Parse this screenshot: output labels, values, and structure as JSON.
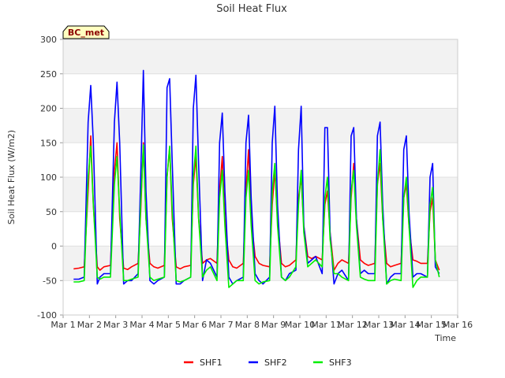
{
  "chart_data": {
    "type": "line",
    "title": "Soil Heat Flux",
    "xlabel": "Time",
    "ylabel": "Soil Heat Flux (W/m2)",
    "badge": "BC_met",
    "xlim": [
      1,
      16
    ],
    "ylim": [
      -100,
      300
    ],
    "x_ticks": [
      {
        "value": 1,
        "label": "Mar 1"
      },
      {
        "value": 2,
        "label": "Mar 2"
      },
      {
        "value": 3,
        "label": "Mar 3"
      },
      {
        "value": 4,
        "label": "Mar 4"
      },
      {
        "value": 5,
        "label": "Mar 5"
      },
      {
        "value": 6,
        "label": "Mar 6"
      },
      {
        "value": 7,
        "label": "Mar 7"
      },
      {
        "value": 8,
        "label": "Mar 8"
      },
      {
        "value": 9,
        "label": "Mar 9"
      },
      {
        "value": 10,
        "label": "Mar 10"
      },
      {
        "value": 11,
        "label": "Mar 11"
      },
      {
        "value": 12,
        "label": "Mar 12"
      },
      {
        "value": 13,
        "label": "Mar 13"
      },
      {
        "value": 14,
        "label": "Mar 14"
      },
      {
        "value": 15,
        "label": "Mar 15"
      },
      {
        "value": 16,
        "label": "Mar 16"
      }
    ],
    "y_ticks": [
      {
        "value": -100,
        "label": "-100"
      },
      {
        "value": -50,
        "label": "-50"
      },
      {
        "value": 0,
        "label": "0"
      },
      {
        "value": 50,
        "label": "50"
      },
      {
        "value": 100,
        "label": "100"
      },
      {
        "value": 150,
        "label": "150"
      },
      {
        "value": 200,
        "label": "200"
      },
      {
        "value": 250,
        "label": "250"
      },
      {
        "value": 300,
        "label": "300"
      }
    ],
    "grid": true,
    "legend_position": "bottom",
    "series": [
      {
        "name": "SHF1",
        "color": "#ff0000",
        "x": [
          1.4,
          1.6,
          1.8,
          1.95,
          2.05,
          2.15,
          2.3,
          2.4,
          2.55,
          2.8,
          2.95,
          3.05,
          3.15,
          3.3,
          3.45,
          3.6,
          3.85,
          3.95,
          4.05,
          4.15,
          4.3,
          4.45,
          4.6,
          4.85,
          4.95,
          5.05,
          5.15,
          5.3,
          5.45,
          5.6,
          5.85,
          5.95,
          6.05,
          6.15,
          6.3,
          6.45,
          6.6,
          6.85,
          6.95,
          7.05,
          7.15,
          7.3,
          7.45,
          7.6,
          7.85,
          7.95,
          8.05,
          8.15,
          8.3,
          8.45,
          8.6,
          8.85,
          8.95,
          9.05,
          9.15,
          9.3,
          9.45,
          9.6,
          9.85,
          9.95,
          10.05,
          10.15,
          10.3,
          10.45,
          10.6,
          10.85,
          10.95,
          11.05,
          11.15,
          11.3,
          11.45,
          11.6,
          11.85,
          11.95,
          12.05,
          12.15,
          12.3,
          12.45,
          12.6,
          12.85,
          12.95,
          13.05,
          13.15,
          13.3,
          13.45,
          13.6,
          13.85,
          13.95,
          14.05,
          14.15,
          14.3,
          14.45,
          14.6,
          14.85,
          14.95,
          15.05,
          15.15,
          15.3
        ],
        "y": [
          -33,
          -32,
          -30,
          80,
          160,
          60,
          -30,
          -35,
          -30,
          -28,
          110,
          150,
          40,
          -32,
          -34,
          -30,
          -25,
          50,
          150,
          40,
          -25,
          -30,
          -32,
          -28,
          100,
          143,
          40,
          -30,
          -33,
          -30,
          -28,
          90,
          130,
          40,
          -25,
          -20,
          -18,
          -25,
          80,
          130,
          40,
          -20,
          -30,
          -32,
          -25,
          80,
          140,
          40,
          -15,
          -25,
          -28,
          -30,
          60,
          110,
          40,
          -25,
          -30,
          -28,
          -20,
          70,
          100,
          30,
          -15,
          -18,
          -15,
          -20,
          60,
          80,
          20,
          -35,
          -25,
          -20,
          -25,
          70,
          120,
          40,
          -20,
          -25,
          -28,
          -25,
          90,
          120,
          40,
          -25,
          -30,
          -28,
          -25,
          70,
          90,
          30,
          -20,
          -22,
          -25,
          -25,
          50,
          70,
          -20,
          -35
        ]
      },
      {
        "name": "SHF2",
        "color": "#0000ff",
        "x": [
          1.4,
          1.6,
          1.8,
          1.95,
          2.05,
          2.15,
          2.3,
          2.4,
          2.55,
          2.8,
          2.95,
          3.05,
          3.15,
          3.3,
          3.45,
          3.6,
          3.85,
          3.95,
          4.05,
          4.15,
          4.3,
          4.45,
          4.6,
          4.85,
          4.95,
          5.05,
          5.15,
          5.3,
          5.45,
          5.6,
          5.85,
          5.95,
          6.05,
          6.15,
          6.3,
          6.45,
          6.6,
          6.85,
          6.95,
          7.05,
          7.15,
          7.3,
          7.45,
          7.6,
          7.85,
          7.95,
          8.05,
          8.15,
          8.3,
          8.45,
          8.6,
          8.85,
          8.95,
          9.05,
          9.15,
          9.3,
          9.45,
          9.6,
          9.85,
          9.95,
          10.05,
          10.15,
          10.3,
          10.45,
          10.6,
          10.85,
          10.95,
          11.05,
          11.15,
          11.3,
          11.45,
          11.6,
          11.85,
          11.95,
          12.05,
          12.15,
          12.3,
          12.45,
          12.6,
          12.85,
          12.95,
          13.05,
          13.15,
          13.3,
          13.45,
          13.6,
          13.85,
          13.95,
          14.05,
          14.15,
          14.3,
          14.45,
          14.6,
          14.85,
          14.95,
          15.05,
          15.15,
          15.3
        ],
        "y": [
          -48,
          -48,
          -45,
          180,
          233,
          150,
          -55,
          -45,
          -40,
          -40,
          180,
          238,
          150,
          -55,
          -50,
          -50,
          -40,
          100,
          255,
          80,
          -50,
          -55,
          -50,
          -45,
          230,
          243,
          120,
          -55,
          -55,
          -50,
          -45,
          200,
          248,
          120,
          -50,
          -20,
          -25,
          -45,
          150,
          193,
          80,
          -45,
          -55,
          -50,
          -45,
          150,
          190,
          70,
          -40,
          -50,
          -55,
          -45,
          150,
          203,
          60,
          -45,
          -50,
          -40,
          -35,
          140,
          203,
          30,
          -25,
          -20,
          -15,
          -40,
          172,
          172,
          20,
          -55,
          -40,
          -35,
          -50,
          160,
          172,
          40,
          -40,
          -35,
          -40,
          -40,
          160,
          180,
          60,
          -55,
          -45,
          -40,
          -40,
          140,
          160,
          50,
          -45,
          -40,
          -40,
          -45,
          100,
          120,
          -30,
          -40
        ]
      },
      {
        "name": "SHF3",
        "color": "#00ee00",
        "x": [
          1.4,
          1.6,
          1.8,
          1.95,
          2.05,
          2.15,
          2.3,
          2.4,
          2.55,
          2.8,
          2.95,
          3.05,
          3.15,
          3.3,
          3.45,
          3.6,
          3.85,
          3.95,
          4.05,
          4.15,
          4.3,
          4.45,
          4.6,
          4.85,
          4.95,
          5.05,
          5.15,
          5.3,
          5.45,
          5.6,
          5.85,
          5.95,
          6.05,
          6.15,
          6.3,
          6.45,
          6.6,
          6.85,
          6.95,
          7.05,
          7.15,
          7.3,
          7.45,
          7.6,
          7.85,
          7.95,
          8.05,
          8.15,
          8.3,
          8.45,
          8.6,
          8.85,
          8.95,
          9.05,
          9.15,
          9.3,
          9.45,
          9.6,
          9.85,
          9.95,
          10.05,
          10.15,
          10.3,
          10.45,
          10.6,
          10.85,
          10.95,
          11.05,
          11.15,
          11.3,
          11.45,
          11.6,
          11.85,
          11.95,
          12.05,
          12.15,
          12.3,
          12.45,
          12.6,
          12.85,
          12.95,
          13.05,
          13.15,
          13.3,
          13.45,
          13.6,
          13.85,
          13.95,
          14.05,
          14.15,
          14.3,
          14.45,
          14.6,
          14.85,
          14.95,
          15.05,
          15.15,
          15.3
        ],
        "y": [
          -52,
          -52,
          -50,
          100,
          145,
          60,
          -45,
          -48,
          -45,
          -45,
          90,
          130,
          50,
          -50,
          -50,
          -48,
          -45,
          60,
          147,
          40,
          -45,
          -50,
          -48,
          -45,
          100,
          145,
          50,
          -50,
          -52,
          -50,
          -45,
          100,
          145,
          40,
          -45,
          -35,
          -30,
          -50,
          70,
          110,
          30,
          -60,
          -55,
          -50,
          -50,
          70,
          110,
          30,
          -50,
          -55,
          -52,
          -50,
          80,
          120,
          30,
          -45,
          -50,
          -45,
          -30,
          60,
          110,
          20,
          -30,
          -25,
          -20,
          -30,
          70,
          100,
          10,
          -40,
          -40,
          -45,
          -50,
          80,
          110,
          30,
          -45,
          -48,
          -50,
          -50,
          90,
          140,
          40,
          -55,
          -50,
          -48,
          -50,
          70,
          100,
          30,
          -60,
          -50,
          -45,
          -45,
          60,
          85,
          -20,
          -45
        ]
      }
    ]
  }
}
